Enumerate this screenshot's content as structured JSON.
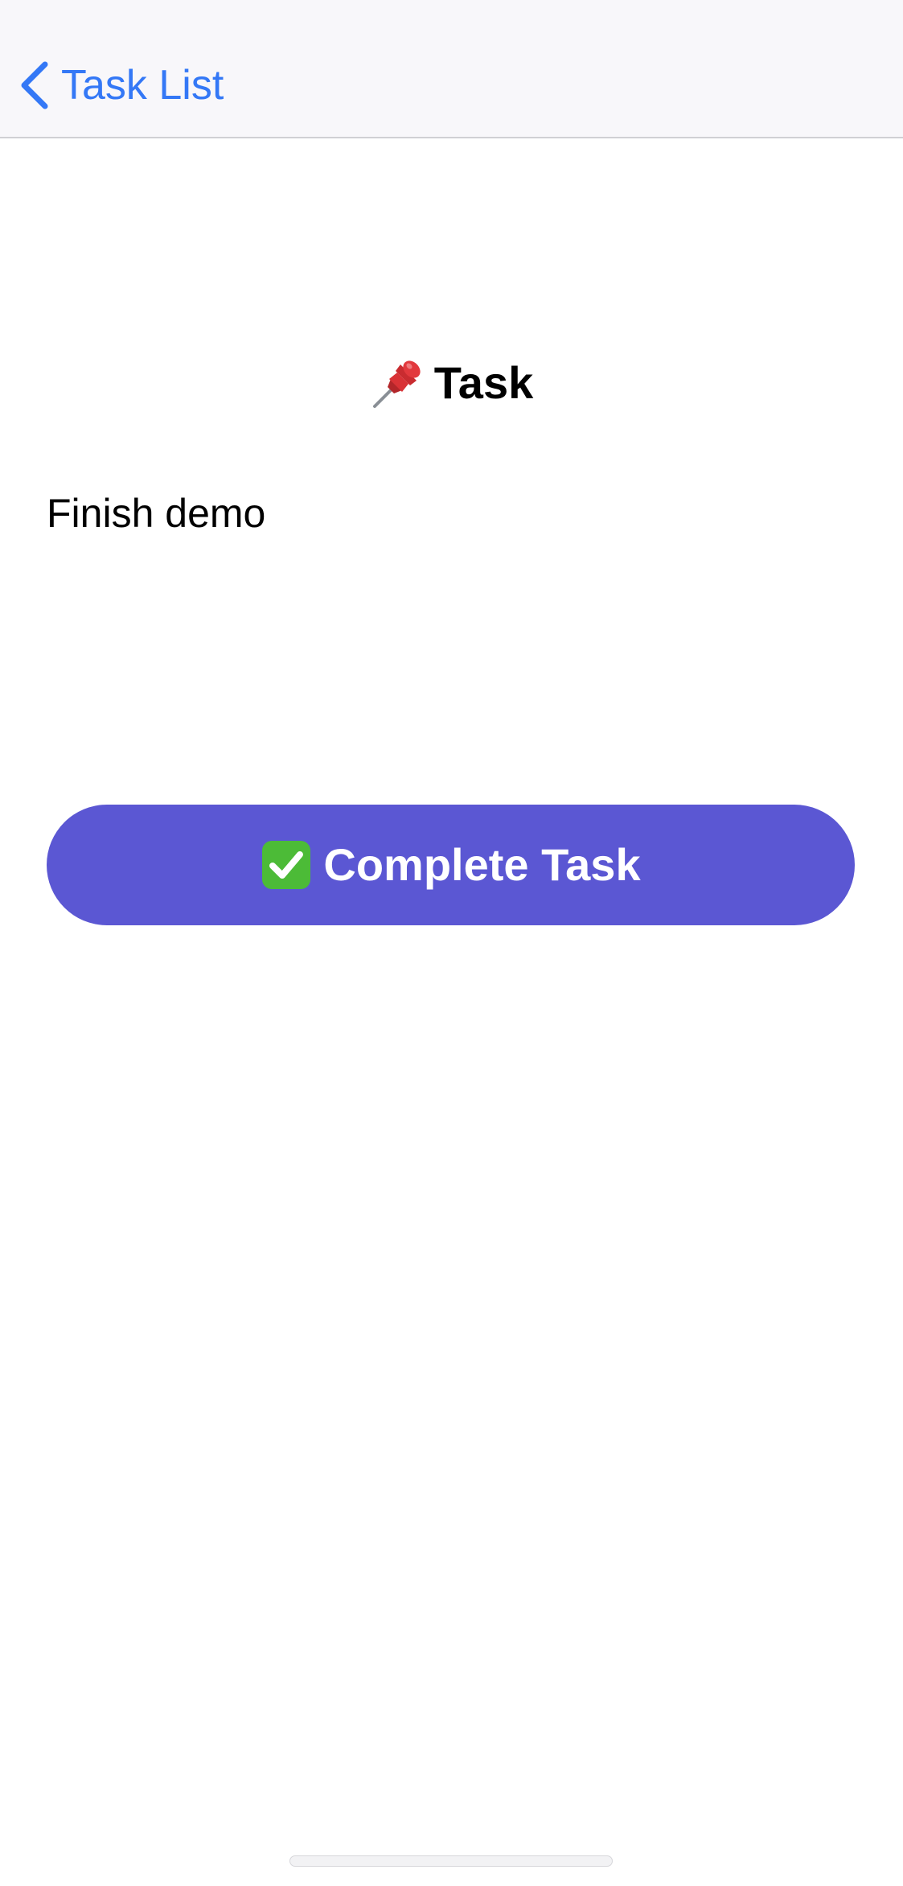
{
  "nav": {
    "back_label": "Task List",
    "back_icon": "chevron-left-icon",
    "accent_color": "#3478f6"
  },
  "detail": {
    "heading_icon": "pushpin-icon",
    "heading": "Task",
    "task_name": "Finish demo"
  },
  "action": {
    "button_icon": "check-mark-icon",
    "button_label": "Complete Task",
    "button_color": "#5b57d3"
  }
}
